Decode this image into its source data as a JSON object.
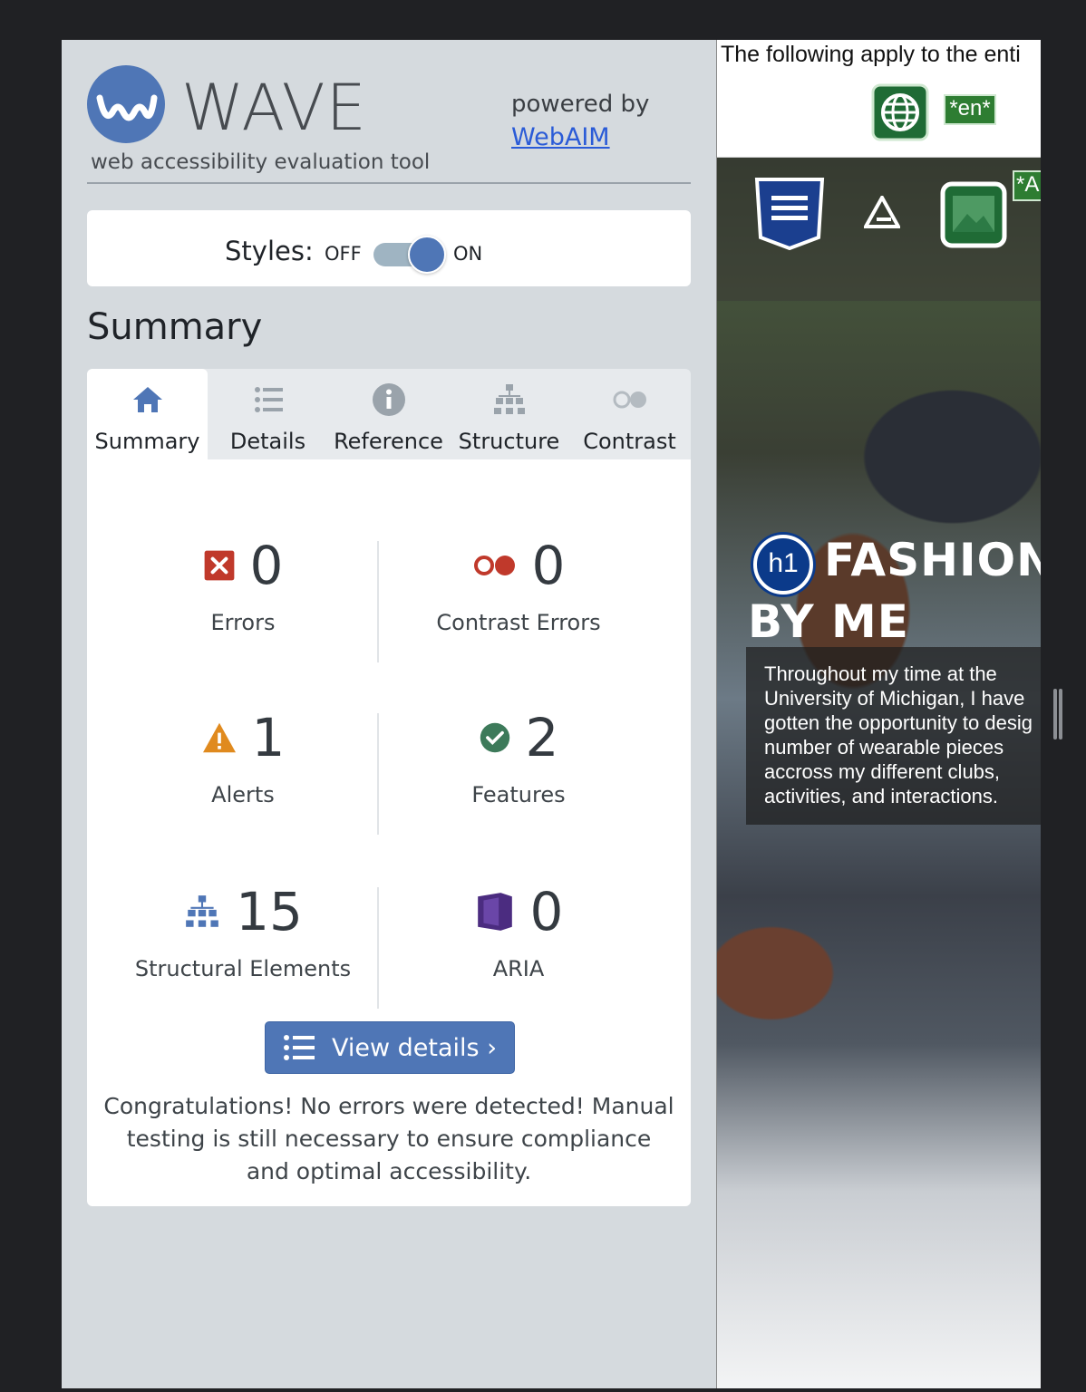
{
  "wave": {
    "logo_word": "WAVE",
    "tagline": "web accessibility evaluation tool",
    "powered_by": "powered by",
    "powered_link": "WebAIM",
    "styles": {
      "label": "Styles:",
      "off": "OFF",
      "on": "ON",
      "enabled": true
    },
    "heading": "Summary",
    "tabs": [
      {
        "label": "Summary",
        "icon": "home-icon",
        "active": true
      },
      {
        "label": "Details",
        "icon": "list-icon",
        "active": false
      },
      {
        "label": "Reference",
        "icon": "info-icon",
        "active": false
      },
      {
        "label": "Structure",
        "icon": "structure-icon",
        "active": false
      },
      {
        "label": "Contrast",
        "icon": "contrast-icon",
        "active": false
      }
    ],
    "stats": {
      "errors": {
        "count": "0",
        "label": "Errors",
        "icon": "error-icon"
      },
      "contrast_errors": {
        "count": "0",
        "label": "Contrast Errors",
        "icon": "contrast-error-icon"
      },
      "alerts": {
        "count": "1",
        "label": "Alerts",
        "icon": "alert-icon"
      },
      "features": {
        "count": "2",
        "label": "Features",
        "icon": "feature-check-icon"
      },
      "structural": {
        "count": "15",
        "label": "Structural Elements",
        "icon": "structure-icon"
      },
      "aria": {
        "count": "0",
        "label": "ARIA",
        "icon": "aria-icon"
      }
    },
    "view_details": "View details ›",
    "congrats": "Congratulations! No errors were detected! Manual testing is still necessary to ensure compliance and optimal accessibility."
  },
  "preview": {
    "apply_text": "The following apply to the enti",
    "lang_badge": "*en*",
    "alt_badge": "*A",
    "h1_badge": "h1",
    "hero_title": "FASHION BY ME",
    "hero_text": "Throughout my time at the University of Michigan, I have gotten the opportunity to desig number of wearable pieces accross my different clubs, activities, and interactions."
  },
  "colors": {
    "accent": "#4f76b6",
    "error": "#c0392b",
    "alert": "#e08a1e",
    "feature": "#3d7a5a",
    "structure": "#4f76b6",
    "aria": "#4b2c80",
    "badge_green": "#2e7d32"
  }
}
